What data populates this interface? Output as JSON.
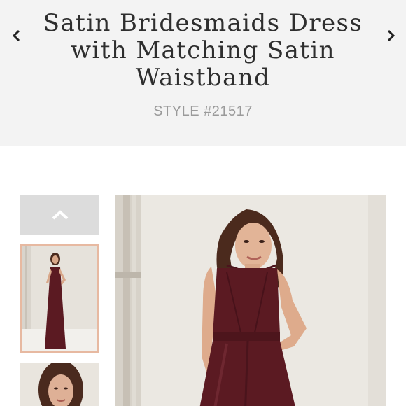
{
  "product": {
    "title": "Satin Bridesmaids Dress with Matching Satin Waistband",
    "style_number": "STYLE #21517"
  },
  "navigation": {
    "prev_icon": "chevron-left-icon",
    "next_icon": "chevron-right-icon",
    "thumbs_up_icon": "chevron-up-icon"
  },
  "gallery": {
    "thumbnails": [
      {
        "label": "full-length dress view",
        "selected": true
      },
      {
        "label": "close-up portrait view",
        "selected": false
      }
    ]
  },
  "colors": {
    "header_bg": "#f3f3f3",
    "selected_border": "#e7b9a1",
    "dress": "#5b1a22",
    "control_bg": "#dcdcdc"
  }
}
